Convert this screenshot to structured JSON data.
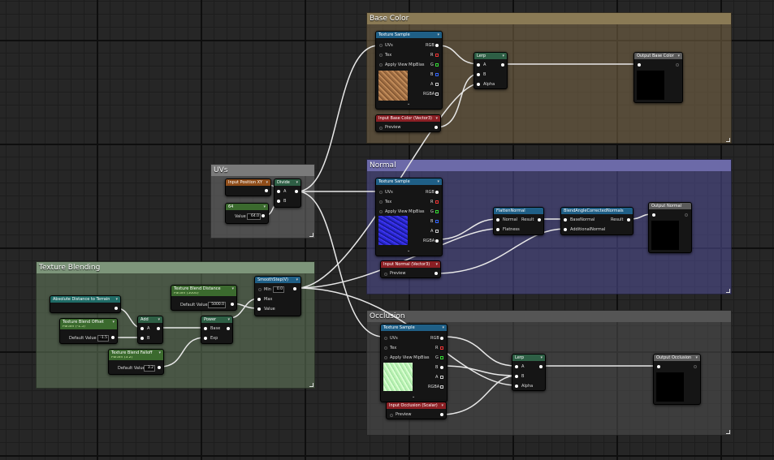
{
  "colors": {
    "comment_color": "#7d6a48",
    "comment_normal": "#4e4c8e",
    "comment_occ": "#4c4c4c",
    "comment_uvs": "#6b6b6b",
    "comment_blend": "#667e5e",
    "texture_sample": "#1f5f86",
    "lerp": "#2e5f45",
    "output": "#5b5b5b",
    "input_param": "#8b1f24",
    "position_param": "#8f4d1a",
    "scalar_param": "#3b6a2e",
    "vector_param": "#1f6b66"
  },
  "comments": {
    "base_color": "Base Color",
    "normal": "Normal",
    "occlusion": "Occlusion",
    "uvs": "UVs",
    "texture_blending": "Texture Blending"
  },
  "uvs": {
    "input_position": "Input Position XY",
    "divide": "Divide",
    "pin_a": "A",
    "pin_b": "B",
    "const_title": "64",
    "value_label": "Value",
    "value": "64.0"
  },
  "blending": {
    "abs_distance": "Absolute Distance to Terrain",
    "tb_distance": {
      "title": "Texture Blend Distance",
      "sub": "Param (5000)",
      "label": "Default Value",
      "value": "5000.0"
    },
    "tb_offset": {
      "title": "Texture Blend Offset",
      "sub": "Param (-1.5)",
      "label": "Default Value",
      "value": "-1.5"
    },
    "tb_falloff": {
      "title": "Texture Blend Falloff",
      "sub": "Param (3.2)",
      "label": "Default Value",
      "value": "3.2"
    },
    "add": "Add",
    "add_a": "A",
    "add_b": "B",
    "power": "Power",
    "base": "Base",
    "exp": "Exp",
    "smoothstep": "SmoothStep(V)",
    "min": "Min",
    "min_val": "0.0",
    "max": "Max",
    "value": "Value"
  },
  "tex_pins": {
    "title": "Texture Sample",
    "uvs": "UVs",
    "tex": "Tex",
    "apply": "Apply View MipBias",
    "rgb": "RGB",
    "r": "R",
    "g": "G",
    "b": "B",
    "a": "A",
    "rgba": "RGBA"
  },
  "base": {
    "lerp": "Lerp",
    "a": "A",
    "b": "B",
    "alpha": "Alpha",
    "input": "Input Base Color (Vector3)",
    "preview": "Preview",
    "output": "Output Base Color"
  },
  "normal": {
    "flatten": "FlattenNormal",
    "normal": "Normal",
    "result": "Result",
    "flatness": "Flatness",
    "blend": "BlendAngleCorrectedNormals",
    "basenormal": "BaseNormal",
    "additional": "AdditionalNormal",
    "result2": "Result",
    "input": "Input Normal (Vector3)",
    "preview": "Preview",
    "output": "Output Normal"
  },
  "occlusion": {
    "lerp": "Lerp",
    "a": "A",
    "b": "B",
    "alpha": "Alpha",
    "input": "Input Occlusion (Scalar)",
    "preview": "Preview",
    "output": "Output Occlusion"
  }
}
